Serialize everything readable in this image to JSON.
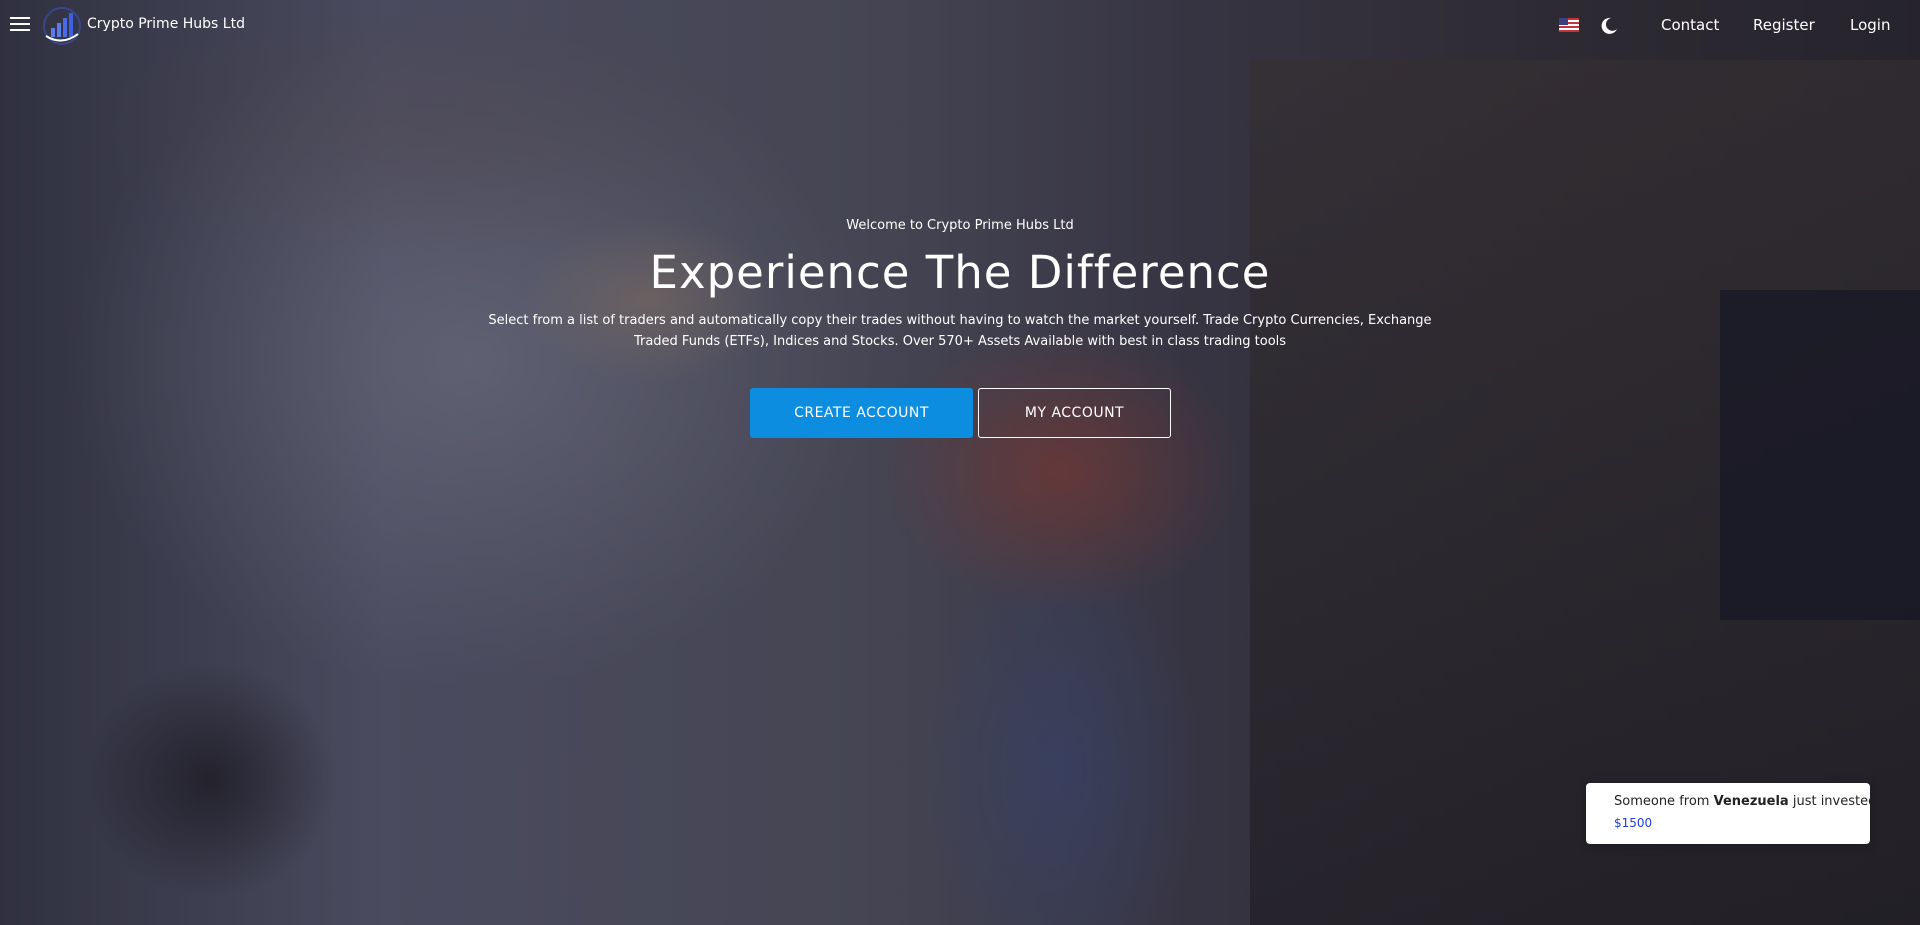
{
  "header": {
    "menu_icon": "hamburger-menu-icon",
    "logo_icon": "crypto-bar-chart-logo",
    "brand_name": "Crypto Prime Hubs Ltd",
    "language_icon": "us-flag-icon",
    "theme_icon": "moon-icon",
    "links": {
      "contact": "Contact",
      "register": "Register",
      "login": "Login"
    }
  },
  "hero": {
    "welcome_text": "Welcome to Crypto Prime Hubs Ltd",
    "headline": "Experience The Difference",
    "description": "Select from a list of traders and automatically copy their trades without having to watch the market yourself. Trade Crypto Currencies, Exchange Traded Funds (ETFs), Indices and Stocks. Over 570+ Assets Available with best in class trading tools",
    "primary_button": "CREATE ACCOUNT",
    "secondary_button": "MY ACCOUNT"
  },
  "notification": {
    "prefix": "Someone from",
    "country": "Venezuela",
    "suffix": "just invested",
    "amount": "$1500"
  },
  "colors": {
    "primary_button": "#0c8de0",
    "amount_text": "#1f3fe0"
  }
}
